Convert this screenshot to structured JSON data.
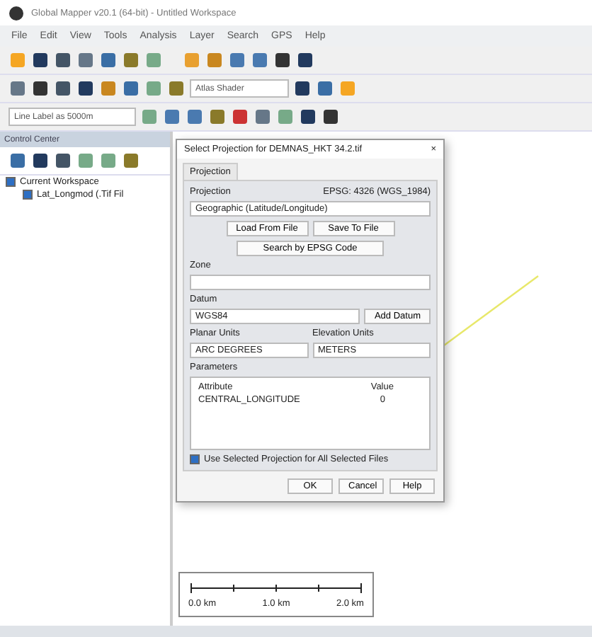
{
  "window": {
    "title": "Global Mapper v20.1 (64-bit) - Untitled Workspace"
  },
  "menu": [
    "File",
    "Edit",
    "View",
    "Tools",
    "Analysis",
    "Layer",
    "Search",
    "GPS",
    "Help"
  ],
  "toolbar": {
    "shader": "Atlas Shader",
    "label_field": "Line Label as 5000m"
  },
  "control_center": {
    "title": "Control Center",
    "tree": [
      {
        "label": "Current Workspace",
        "checked": true,
        "children": [
          {
            "label": "Lat_Longmod (.Tif Fil",
            "checked": true
          }
        ]
      }
    ]
  },
  "dialog": {
    "title": "Select Projection for DEMNAS_HKT 34.2.tif",
    "close": "×",
    "tabs": [
      {
        "label": "Projection",
        "selected": true
      }
    ],
    "projection_label": "Projection",
    "epsg": "EPSG: 4326 (WGS_1984)",
    "projection": "Geographic (Latitude/Longitude)",
    "buttons_top": [
      "Load From File",
      "Save To File"
    ],
    "search_button": "Search by EPSG Code",
    "zone_label": "Zone",
    "datum_label": "Datum",
    "datum": "WGS84",
    "add_datum": "Add Datum",
    "planar_label": "Planar Units",
    "planar": "ARC DEGREES",
    "elevation_label": "Elevation Units",
    "elevation": "METERS",
    "parameters_label": "Parameters",
    "param_header": [
      "Attribute",
      "Value"
    ],
    "params": [
      {
        "name": "CENTRAL_LONGITUDE",
        "value": "0"
      }
    ],
    "apply_all": {
      "label": "Use Selected Projection for All Selected Files",
      "checked": true
    },
    "buttons": [
      "OK",
      "Cancel",
      "Help"
    ]
  },
  "scale_bar": [
    "0.0 km",
    "1.0 km",
    "2.0 km"
  ]
}
